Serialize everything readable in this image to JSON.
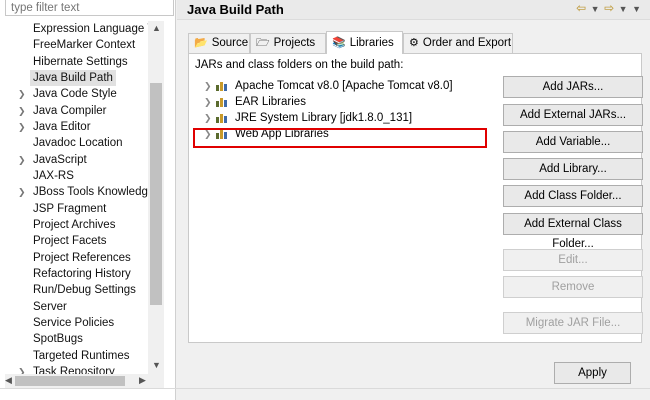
{
  "filter": {
    "placeholder": "type filter text"
  },
  "tree": {
    "items": [
      {
        "label": "Expression Language Va",
        "expandable": false
      },
      {
        "label": "FreeMarker Context",
        "expandable": false
      },
      {
        "label": "Hibernate Settings",
        "expandable": false
      },
      {
        "label": "Java Build Path",
        "expandable": false,
        "selected": true
      },
      {
        "label": "Java Code Style",
        "expandable": true
      },
      {
        "label": "Java Compiler",
        "expandable": true
      },
      {
        "label": "Java Editor",
        "expandable": true
      },
      {
        "label": "Javadoc Location",
        "expandable": false
      },
      {
        "label": "JavaScript",
        "expandable": true
      },
      {
        "label": "JAX-RS",
        "expandable": false
      },
      {
        "label": "JBoss Tools Knowledge",
        "expandable": true
      },
      {
        "label": "JSP Fragment",
        "expandable": false
      },
      {
        "label": "Project Archives",
        "expandable": false
      },
      {
        "label": "Project Facets",
        "expandable": false
      },
      {
        "label": "Project References",
        "expandable": false
      },
      {
        "label": "Refactoring History",
        "expandable": false
      },
      {
        "label": "Run/Debug Settings",
        "expandable": false
      },
      {
        "label": "Server",
        "expandable": false
      },
      {
        "label": "Service Policies",
        "expandable": false
      },
      {
        "label": "SpotBugs",
        "expandable": false
      },
      {
        "label": "Targeted Runtimes",
        "expandable": false
      },
      {
        "label": "Task Repository",
        "expandable": true
      }
    ]
  },
  "header": {
    "title": "Java Build Path"
  },
  "tabs": {
    "source": "Source",
    "projects": "Projects",
    "libraries": "Libraries",
    "order": "Order and Export"
  },
  "panel": {
    "label": "JARs and class folders on the build path:",
    "libraries": [
      "Apache Tomcat v8.0 [Apache Tomcat v8.0]",
      "EAR Libraries",
      "JRE System Library [jdk1.8.0_131]",
      "Web App Libraries"
    ]
  },
  "buttons": {
    "add_jars": "Add JARs...",
    "add_external_jars": "Add External JARs...",
    "add_variable": "Add Variable...",
    "add_library": "Add Library...",
    "add_class_folder": "Add Class Folder...",
    "add_external_class_folder": "Add External Class Folder...",
    "edit": "Edit...",
    "remove": "Remove",
    "migrate_jar": "Migrate JAR File...",
    "apply": "Apply"
  },
  "colors": {
    "highlight": "#e00000",
    "selection": "#e1e1e1"
  }
}
